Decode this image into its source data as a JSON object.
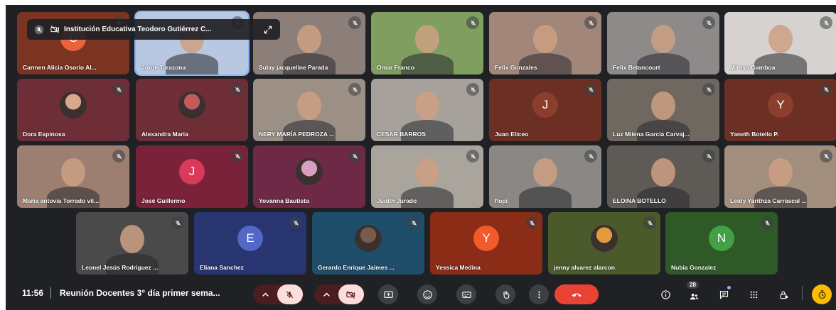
{
  "pip": {
    "title": "Institución Educativa Teodoro Gutiérrez C..."
  },
  "colors": {
    "background": "#202124",
    "end_call": "#ea4335",
    "muted_control_bg": "#f9dedc",
    "accent": "#8ab4f8"
  },
  "participants": [
    {
      "name": "Carmen Alicia Osorio Al...",
      "kind": "avatar",
      "letter": "C",
      "avatar_color": "#e8623a",
      "tile_color": "#7b3322"
    },
    {
      "name": "Jorge Tarazona",
      "kind": "video",
      "tile_color": "#b8c8e0",
      "highlight": true
    },
    {
      "name": "Sulay jacqueline Parada",
      "kind": "video",
      "tile_color": "#8c7f79"
    },
    {
      "name": "Omar Franco",
      "kind": "video",
      "tile_color": "#7f9e5f"
    },
    {
      "name": "Felix Gonzales",
      "kind": "video",
      "tile_color": "#a2867a"
    },
    {
      "name": "Felix Betancourt",
      "kind": "video",
      "tile_color": "#8e8a89"
    },
    {
      "name": "Mireya Gamboa",
      "kind": "video",
      "tile_color": "#d6d2cf"
    },
    {
      "name": "Dora Espinosa",
      "kind": "photo",
      "tile_color": "#6e2e37",
      "photo_color": "#d9a88c"
    },
    {
      "name": "Alexandra Maria",
      "kind": "photo",
      "tile_color": "#6e2e37",
      "photo_color": "#c45a5a"
    },
    {
      "name": "NERY MARÍA PEDROZA ...",
      "kind": "video",
      "tile_color": "#9c8f86"
    },
    {
      "name": "CESAR BARROS",
      "kind": "video",
      "tile_color": "#a6a19a"
    },
    {
      "name": "Juan Eliceo",
      "kind": "avatar",
      "letter": "J",
      "avatar_color": "#8a3e2b",
      "tile_color": "#6b2f23"
    },
    {
      "name": "Luz Milena García Carvaj...",
      "kind": "video",
      "tile_color": "#6f6860"
    },
    {
      "name": "Yaneth Botello P.",
      "kind": "avatar",
      "letter": "Y",
      "avatar_color": "#8a3e2b",
      "tile_color": "#6b2f23"
    },
    {
      "name": "Maria antovia Torrado vil...",
      "kind": "video",
      "tile_color": "#9d7f72"
    },
    {
      "name": "José Guillermo",
      "kind": "avatar",
      "letter": "J",
      "avatar_color": "#d93a5a",
      "tile_color": "#7a2239"
    },
    {
      "name": "Yovanna Bautista",
      "kind": "photo",
      "tile_color": "#6d2946",
      "photo_color": "#d8a0c0"
    },
    {
      "name": "Judith Jurado",
      "kind": "video",
      "tile_color": "#a9a49c"
    },
    {
      "name": "flopi",
      "kind": "video",
      "tile_color": "#8a8784"
    },
    {
      "name": "ELOINA BOTELLO",
      "kind": "video",
      "tile_color": "#5e5a56"
    },
    {
      "name": "Leidy Yarithza Carrascal ...",
      "kind": "video",
      "tile_color": "#a28e7d"
    },
    {
      "name": "Leonel Jesús Rodríguez ...",
      "kind": "video",
      "tile_color": "#4a4a4a"
    },
    {
      "name": "Eliana Sanchez",
      "kind": "avatar",
      "letter": "E",
      "avatar_color": "#5367c6",
      "tile_color": "#283571"
    },
    {
      "name": "Gerardo Enrique Jaimes ...",
      "kind": "photo",
      "tile_color": "#1f4e6a",
      "photo_color": "#7a5a48"
    },
    {
      "name": "Yessica Medina",
      "kind": "avatar",
      "letter": "Y",
      "avatar_color": "#f25a2c",
      "tile_color": "#8b2c17"
    },
    {
      "name": "jenny alvarez alarcon",
      "kind": "photo",
      "tile_color": "#4a5a2a",
      "photo_color": "#e39a3b"
    },
    {
      "name": "Nubia Gonzalez",
      "kind": "avatar",
      "letter": "N",
      "avatar_color": "#43a047",
      "tile_color": "#2f5a27"
    }
  ],
  "toolbar": {
    "time": "11:56",
    "meeting_title": "Reunión Docentes 3° día primer sema...",
    "participant_count": "28",
    "icons": [
      "chevron-up-icon",
      "mic-off-icon",
      "chevron-up-icon",
      "camera-off-icon",
      "present-icon",
      "emoji-icon",
      "captions-icon",
      "raise-hand-icon",
      "more-icon",
      "end-call-icon",
      "info-icon",
      "people-icon",
      "chat-icon",
      "activities-icon",
      "host-controls-icon",
      "timer-icon"
    ]
  }
}
